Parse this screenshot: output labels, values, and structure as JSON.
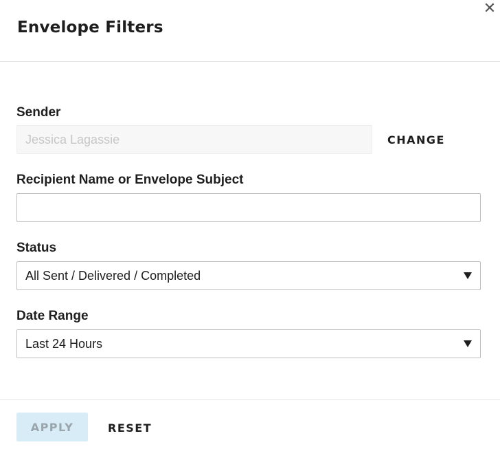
{
  "dialog": {
    "title": "Envelope Filters",
    "close_glyph": "✕"
  },
  "sender": {
    "label": "Sender",
    "value": "Jessica Lagassie",
    "change_label": "CHANGE"
  },
  "recipient": {
    "label": "Recipient Name or Envelope Subject",
    "value": "",
    "placeholder": ""
  },
  "status": {
    "label": "Status",
    "selected": "All Sent / Delivered / Completed"
  },
  "date_range": {
    "label": "Date Range",
    "selected": "Last 24 Hours"
  },
  "footer": {
    "apply_label": "APPLY",
    "reset_label": "RESET"
  },
  "colors": {
    "apply_disabled_bg": "#d8ecf8",
    "apply_disabled_text": "#9aa4ab",
    "text": "#1e1e1e"
  },
  "icons": {
    "close": "close-icon",
    "dropdown": "caret-down-icon"
  }
}
